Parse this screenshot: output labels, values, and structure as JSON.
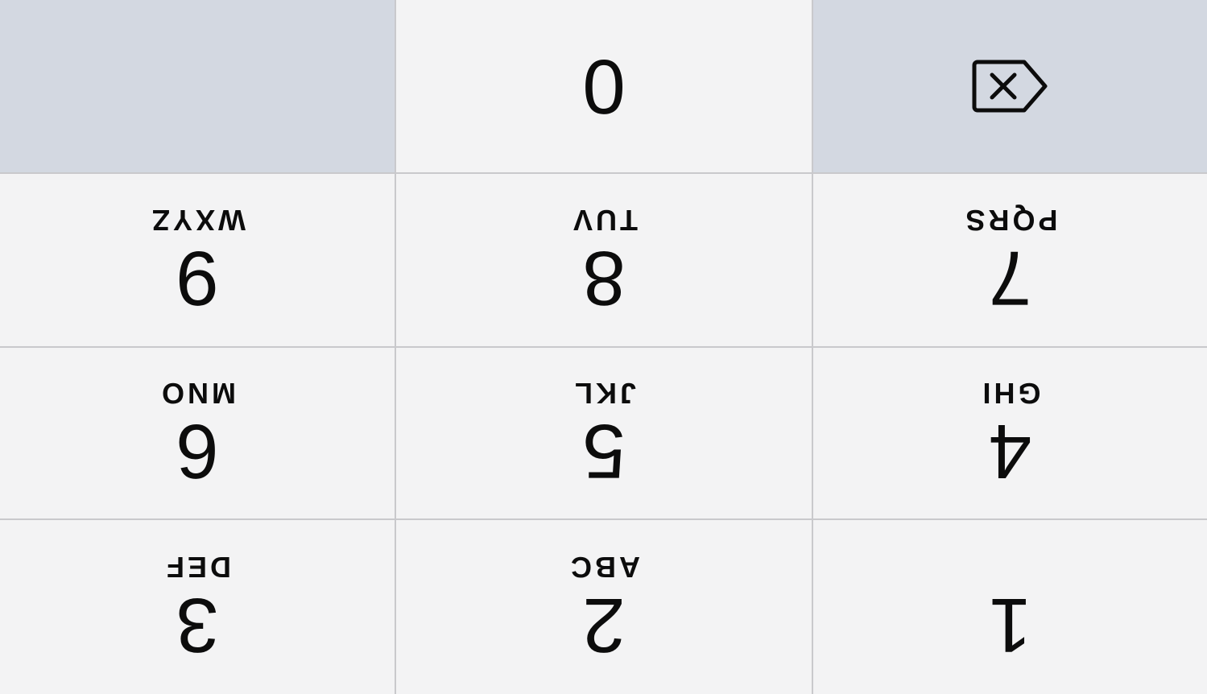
{
  "keypad": {
    "keys": [
      {
        "digit": "1",
        "letters": ""
      },
      {
        "digit": "2",
        "letters": "ABC"
      },
      {
        "digit": "3",
        "letters": "DEF"
      },
      {
        "digit": "4",
        "letters": "GHI"
      },
      {
        "digit": "5",
        "letters": "JKL"
      },
      {
        "digit": "6",
        "letters": "MNO"
      },
      {
        "digit": "7",
        "letters": "PQRS"
      },
      {
        "digit": "8",
        "letters": "TUV"
      },
      {
        "digit": "9",
        "letters": "WXYZ"
      }
    ],
    "zero": {
      "digit": "0"
    },
    "delete": {
      "icon": "delete-backspace-icon"
    },
    "colors": {
      "key_bg": "#f3f3f4",
      "function_key_bg": "#d3d8e1",
      "divider": "#c9c9cc",
      "text": "#0c0c0c"
    }
  }
}
